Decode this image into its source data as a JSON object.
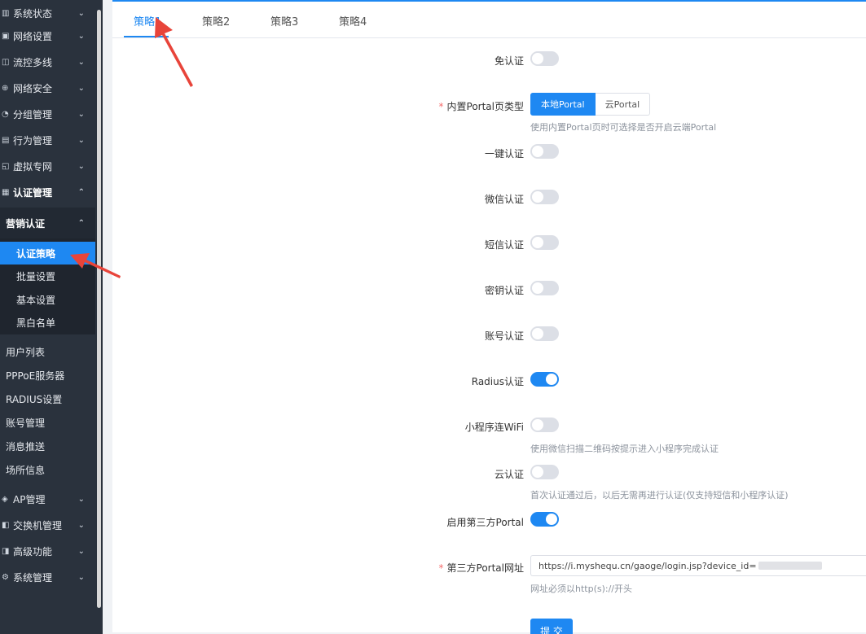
{
  "sidebar": {
    "menu": [
      {
        "label": "系统状态",
        "icon": "chart-icon"
      },
      {
        "label": "网络设置",
        "icon": "network-icon"
      },
      {
        "label": "流控多线",
        "icon": "flow-icon"
      },
      {
        "label": "网络安全",
        "icon": "shield-icon"
      },
      {
        "label": "分组管理",
        "icon": "group-icon"
      },
      {
        "label": "行为管理",
        "icon": "behavior-icon"
      },
      {
        "label": "虚拟专网",
        "icon": "vpn-icon"
      },
      {
        "label": "认证管理",
        "icon": "auth-icon"
      }
    ],
    "submenu_head": "营销认证",
    "sub_items": [
      "认证策略",
      "批量设置",
      "基本设置",
      "黑白名单"
    ],
    "plain_items": [
      "用户列表",
      "PPPoE服务器",
      "RADIUS设置",
      "账号管理",
      "消息推送",
      "场所信息"
    ],
    "bottom_menu": [
      {
        "label": "AP管理",
        "icon": "ap-icon"
      },
      {
        "label": "交换机管理",
        "icon": "switch-icon"
      },
      {
        "label": "高级功能",
        "icon": "advanced-icon"
      },
      {
        "label": "系统管理",
        "icon": "gear-icon"
      }
    ]
  },
  "tabs": [
    "策略1",
    "策略2",
    "策略3",
    "策略4"
  ],
  "form": {
    "no_auth": {
      "label": "免认证",
      "on": false
    },
    "portal_type": {
      "label": "内置Portal页类型",
      "options": [
        "本地Portal",
        "云Portal"
      ],
      "selected": "本地Portal",
      "hint": "使用内置Portal页时可选择是否开启云端Portal"
    },
    "one_click": {
      "label": "一键认证",
      "on": false
    },
    "wechat": {
      "label": "微信认证",
      "on": false
    },
    "sms": {
      "label": "短信认证",
      "on": false
    },
    "key": {
      "label": "密钥认证",
      "on": false
    },
    "account": {
      "label": "账号认证",
      "on": false
    },
    "radius": {
      "label": "Radius认证",
      "on": true
    },
    "miniprogram": {
      "label": "小程序连WiFi",
      "on": false,
      "hint": "使用微信扫描二维码按提示进入小程序完成认证"
    },
    "cloud_auth": {
      "label": "云认证",
      "on": false,
      "hint": "首次认证通过后，以后无需再进行认证(仅支持短信和小程序认证)"
    },
    "third_party": {
      "label": "启用第三方Portal",
      "on": true
    },
    "third_url": {
      "label": "第三方Portal网址",
      "value": "https://i.myshequ.cn/gaoge/login.jsp?device_id=",
      "hint": "网址必须以http(s)://开头"
    },
    "submit_label": "提 交"
  },
  "colors": {
    "accent": "#1e88f2",
    "sidebar": "#2a323d",
    "required": "#f56c6c",
    "arrow": "#e8443a"
  }
}
